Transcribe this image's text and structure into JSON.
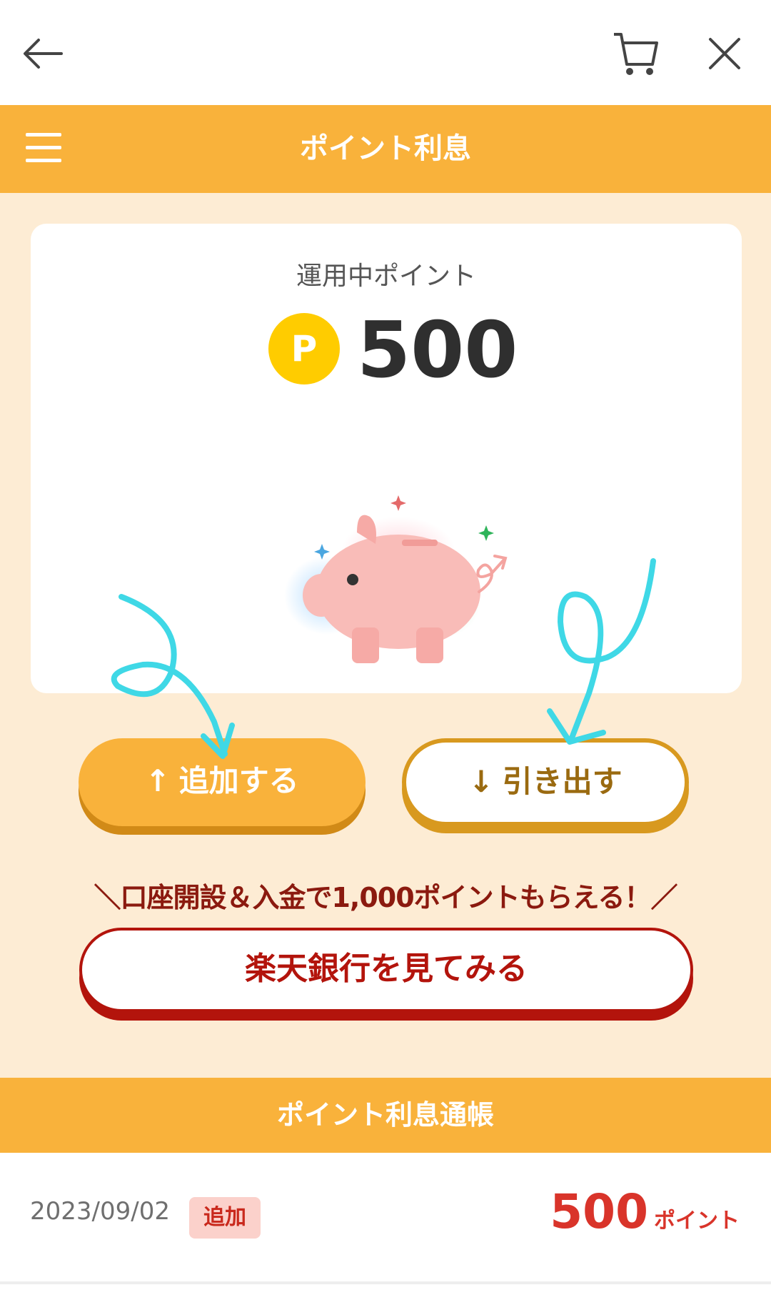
{
  "header": {
    "title": "ポイント利息"
  },
  "icons": {
    "back": "arrow-left-icon",
    "cart": "cart-icon",
    "close": "close-icon",
    "menu": "hamburger-menu-icon",
    "coin": "point-coin-icon",
    "piggy": "piggy-bank-illustration"
  },
  "card": {
    "label": "運用中ポイント",
    "coin_letter": "P",
    "points": "500"
  },
  "buttons": {
    "add_arrow": "↑",
    "add": "追加する",
    "withdraw_arrow": "↓",
    "withdraw": "引き出す"
  },
  "promo": {
    "text": "＼口座開設＆入金で1,000ポイントもらえる！／",
    "bank_button": "楽天銀行を見てみる"
  },
  "passbook": {
    "title": "ポイント利息通帳",
    "entries": [
      {
        "date": "2023/09/02",
        "type": "追加",
        "amount": "500",
        "unit": "ポイント"
      }
    ]
  },
  "colors": {
    "accent": "#f9b23b",
    "background": "#fdecd4",
    "bank_red": "#b3140c",
    "amount_red": "#d9342a",
    "annotation": "#3fd8e6"
  }
}
